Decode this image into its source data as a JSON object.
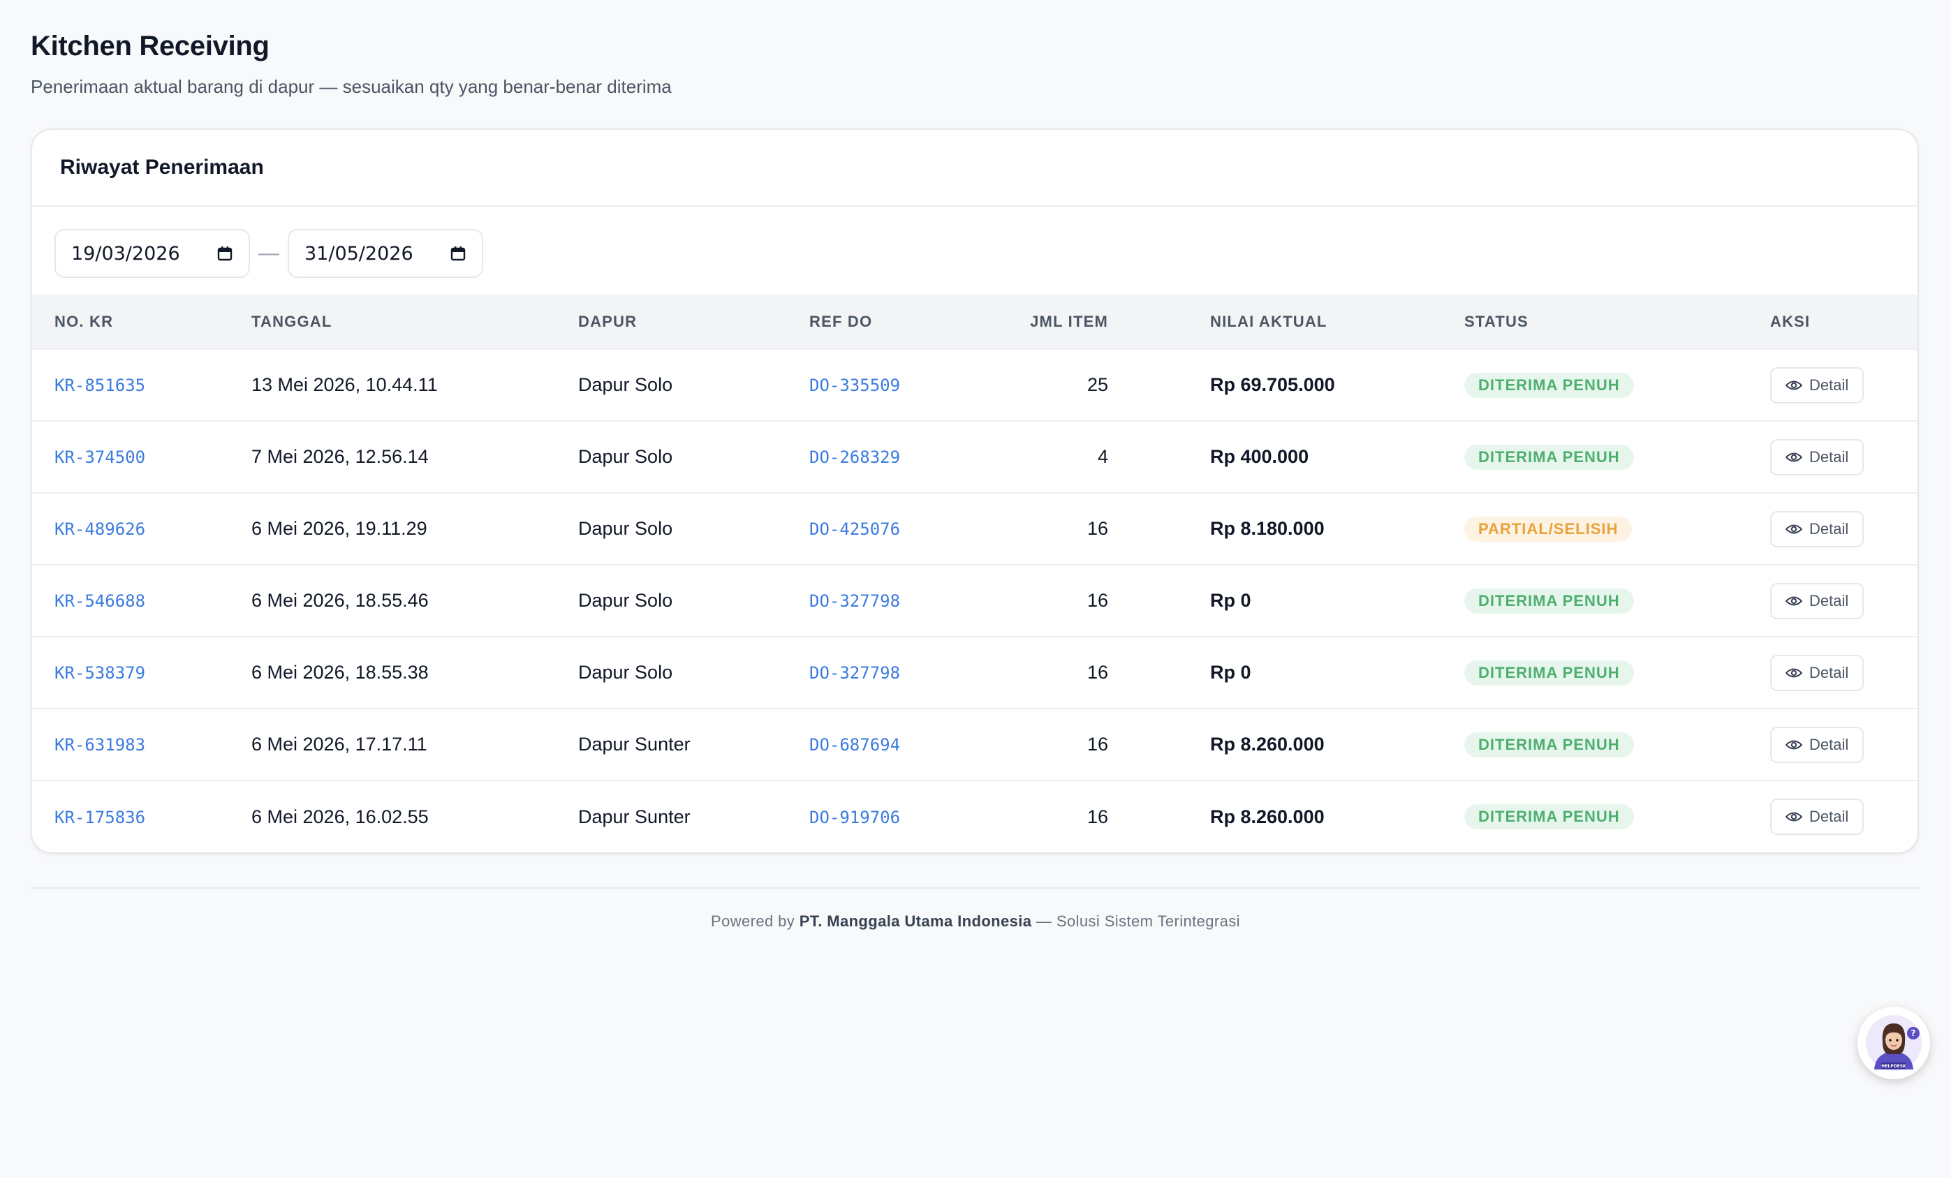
{
  "page": {
    "title": "Kitchen Receiving",
    "subtitle": "Penerimaan aktual barang di dapur — sesuaikan qty yang benar-benar diterima"
  },
  "card": {
    "title": "Riwayat Penerimaan",
    "date_from": "19/03/2026",
    "date_separator": "—",
    "date_to": "31/05/2026"
  },
  "table": {
    "headers": [
      "NO. KR",
      "TANGGAL",
      "DAPUR",
      "REF DO",
      "JML ITEM",
      "NILAI AKTUAL",
      "STATUS",
      "AKSI"
    ],
    "detail_label": "Detail",
    "rows": [
      {
        "no_kr": "KR-851635",
        "tanggal": "13 Mei 2026, 10.44.11",
        "dapur": "Dapur Solo",
        "ref_do": "DO-335509",
        "jml_item": "25",
        "nilai": "Rp 69.705.000",
        "status": "DITERIMA PENUH",
        "status_type": "ok"
      },
      {
        "no_kr": "KR-374500",
        "tanggal": "7 Mei 2026, 12.56.14",
        "dapur": "Dapur Solo",
        "ref_do": "DO-268329",
        "jml_item": "4",
        "nilai": "Rp 400.000",
        "status": "DITERIMA PENUH",
        "status_type": "ok"
      },
      {
        "no_kr": "KR-489626",
        "tanggal": "6 Mei 2026, 19.11.29",
        "dapur": "Dapur Solo",
        "ref_do": "DO-425076",
        "jml_item": "16",
        "nilai": "Rp 8.180.000",
        "status": "PARTIAL/SELISIH",
        "status_type": "warn"
      },
      {
        "no_kr": "KR-546688",
        "tanggal": "6 Mei 2026, 18.55.46",
        "dapur": "Dapur Solo",
        "ref_do": "DO-327798",
        "jml_item": "16",
        "nilai": "Rp 0",
        "status": "DITERIMA PENUH",
        "status_type": "ok"
      },
      {
        "no_kr": "KR-538379",
        "tanggal": "6 Mei 2026, 18.55.38",
        "dapur": "Dapur Solo",
        "ref_do": "DO-327798",
        "jml_item": "16",
        "nilai": "Rp 0",
        "status": "DITERIMA PENUH",
        "status_type": "ok"
      },
      {
        "no_kr": "KR-631983",
        "tanggal": "6 Mei 2026, 17.17.11",
        "dapur": "Dapur Sunter",
        "ref_do": "DO-687694",
        "jml_item": "16",
        "nilai": "Rp 8.260.000",
        "status": "DITERIMA PENUH",
        "status_type": "ok"
      },
      {
        "no_kr": "KR-175836",
        "tanggal": "6 Mei 2026, 16.02.55",
        "dapur": "Dapur Sunter",
        "ref_do": "DO-919706",
        "jml_item": "16",
        "nilai": "Rp 8.260.000",
        "status": "DITERIMA PENUH",
        "status_type": "ok"
      }
    ]
  },
  "footer": {
    "prefix": "Powered by",
    "company": "PT. Manggala Utama Indonesia",
    "suffix": "— Solusi Sistem Terintegrasi"
  },
  "helpdesk": {
    "icon": "helpdesk-avatar-icon",
    "label": "HELPDESK"
  },
  "colors": {
    "link": "#3b7be0",
    "status_ok_text": "#4caf6e",
    "status_ok_bg": "#e7f6ec",
    "status_warn_text": "#e8a23a",
    "status_warn_bg": "#fef3e3",
    "helpdesk_purple": "#5b4fc4"
  }
}
